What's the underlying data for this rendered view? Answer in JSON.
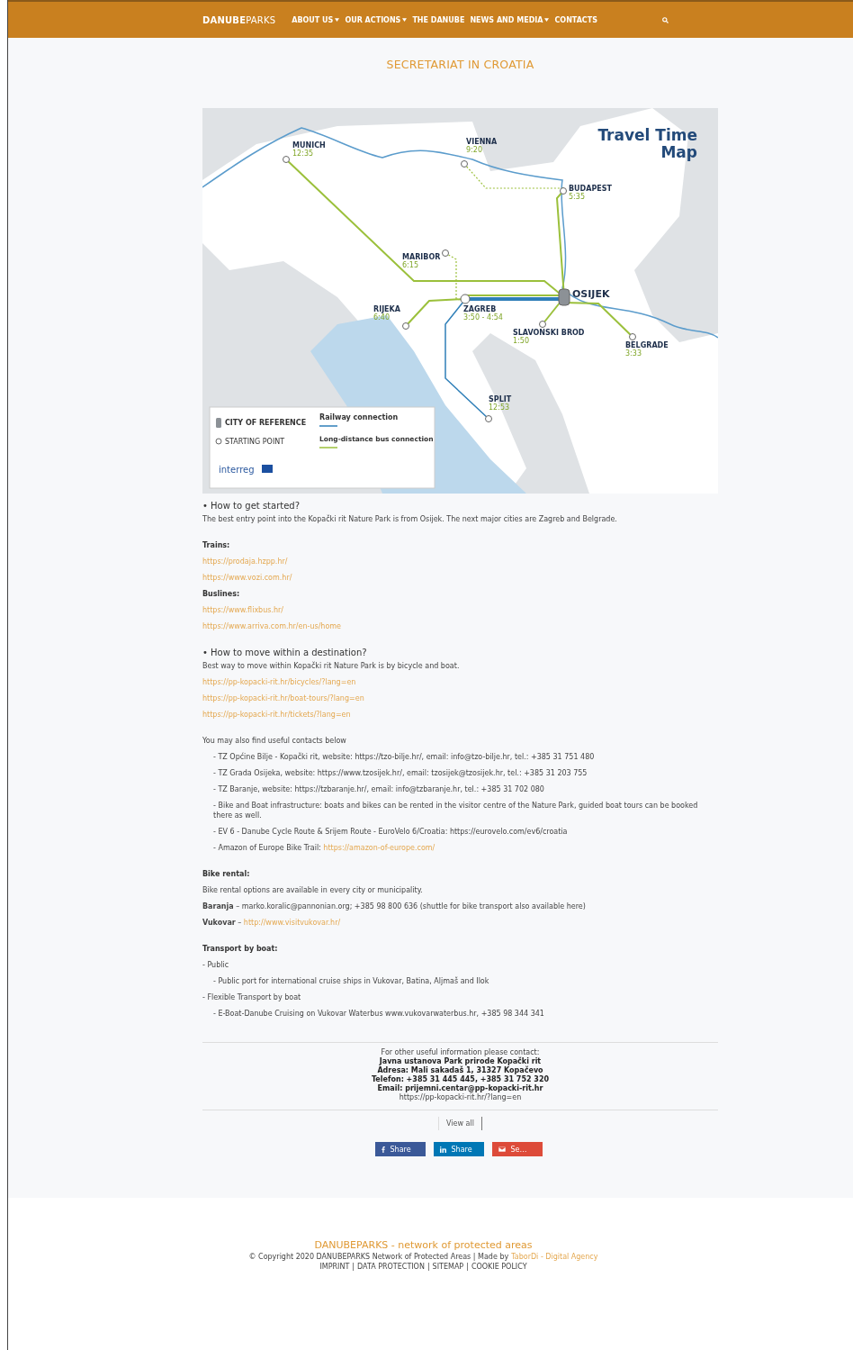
{
  "nav": {
    "logo_bold": "DANUBE",
    "logo_light": "PARKS",
    "items": [
      {
        "label": "ABOUT US",
        "dropdown": true
      },
      {
        "label": "OUR ACTIONS",
        "dropdown": true
      },
      {
        "label": "THE DANUBE",
        "dropdown": false
      },
      {
        "label": "NEWS AND MEDIA",
        "dropdown": true
      },
      {
        "label": "CONTACTS",
        "dropdown": false
      }
    ]
  },
  "title": "SECRETARIAT IN CROATIA",
  "map": {
    "title_lines": [
      "Travel Time",
      "Map"
    ],
    "cities": [
      {
        "name": "MUNICH",
        "time": "12:35",
        "kind": "start"
      },
      {
        "name": "VIENNA",
        "time": "9:20",
        "kind": "start"
      },
      {
        "name": "BUDAPEST",
        "time": "5:35",
        "kind": "start"
      },
      {
        "name": "MARIBOR",
        "time": "6:15",
        "kind": "start"
      },
      {
        "name": "OSIJEK",
        "kind": "reference"
      },
      {
        "name": "RIJEKA",
        "time": "6:40",
        "kind": "start"
      },
      {
        "name": "ZAGREB",
        "time": "3:50 - 4:54",
        "kind": "start"
      },
      {
        "name": "SLAVONSKI BROD",
        "time": "1:50",
        "kind": "start"
      },
      {
        "name": "BELGRADE",
        "time": "3:33",
        "kind": "start"
      },
      {
        "name": "SPLIT",
        "time": "12:53",
        "kind": "start"
      }
    ],
    "legend": {
      "reference": "CITY OF REFERENCE",
      "start": "STARTING POINT",
      "rail": "Railway connection",
      "bus": "Long-distance bus connection",
      "logo": "interreg"
    }
  },
  "groups": [
    [
      {
        "kind": "heading",
        "text": "• How to get started?"
      },
      {
        "kind": "text",
        "text": "The best entry point into the Kopački rit Nature Park is from Osijek. The next major cities are Zagreb and Belgrade."
      }
    ],
    [
      {
        "kind": "label",
        "text": "Trains:"
      },
      {
        "kind": "link",
        "text": "https://prodaja.hzpp.hr/"
      },
      {
        "kind": "link",
        "text": "https://www.vozi.com.hr/"
      },
      {
        "kind": "label",
        "text": "Buslines:"
      },
      {
        "kind": "link",
        "text": "https://www.flixbus.hr/"
      },
      {
        "kind": "link",
        "text": "https://www.arriva.com.hr/en-us/home"
      }
    ],
    [
      {
        "kind": "heading",
        "text": "• How to move within a destination?"
      },
      {
        "kind": "text",
        "text": "Best way to move within Kopački rit Nature Park is by bicycle and boat."
      },
      {
        "kind": "link",
        "text": "https://pp-kopacki-rit.hr/bicycles/?lang=en"
      },
      {
        "kind": "link",
        "text": "https://pp-kopacki-rit.hr/boat-tours/?lang=en"
      },
      {
        "kind": "link",
        "text": "https://pp-kopacki-rit.hr/tickets/?lang=en"
      }
    ],
    [
      {
        "kind": "text",
        "text": "You may also find useful contacts below"
      },
      {
        "kind": "item",
        "text": "- TZ Općine Bilje - Kopački rit, website: https://tzo-bilje.hr/, email: info@tzo-bilje.hr, tel.: +385 31 751 480"
      },
      {
        "kind": "item",
        "text": "- TZ Grada Osijeka, website: https://www.tzosijek.hr/, email: tzosijek@tzosijek.hr, tel.: +385 31 203 755"
      },
      {
        "kind": "item",
        "text": "- TZ Baranje, website: https://tzbaranje.hr/, email: info@tzbaranje.hr, tel.: +385 31 702 080"
      },
      {
        "kind": "item",
        "text": "- Bike and Boat infrastructure: boats and bikes can be rented in the visitor centre of the Nature Park, guided boat tours can be booked there as well."
      },
      {
        "kind": "item",
        "text": "- EV 6 - Danube Cycle Route & Srijem Route - EuroVelo 6/Croatia: https://eurovelo.com/ev6/croatia"
      },
      {
        "kind": "item",
        "text": "- Amazon of Europe Bike Trail:",
        "link": "https://amazon-of-europe.com/"
      }
    ],
    [
      {
        "kind": "label",
        "text": "Bike rental:"
      },
      {
        "kind": "text",
        "text": "Bike rental options are available in every city or municipality."
      },
      {
        "kind": "text",
        "text": "**Baranja** – marko.koralic@pannonian.org; +385 98 800 636 (shuttle for bike transport also available here)"
      },
      {
        "kind": "text",
        "text": "**Vukovar** –",
        "link": "http://www.visitvukovar.hr/"
      }
    ],
    [
      {
        "kind": "label",
        "text": "Transport by boat:"
      },
      {
        "kind": "text",
        "text": "- Public"
      },
      {
        "kind": "item",
        "text": "- Public port for international cruise ships in Vukovar, Batina, Aljmaš and Ilok"
      },
      {
        "kind": "text",
        "text": "- Flexible Transport by boat"
      },
      {
        "kind": "item",
        "text": "- E-Boat-Danube Cruising on Vukovar Waterbus www.vukovarwaterbus.hr, +385 98 344 341"
      }
    ]
  ],
  "contact": [
    {
      "kind": "text",
      "text": "For other useful information please contact:"
    },
    {
      "kind": "bold",
      "text": "Javna ustanova Park prirode Kopački rit"
    },
    {
      "kind": "bold",
      "text": "Adresa: Mali sakadaš 1, 31327 Kopačevo"
    },
    {
      "kind": "bold",
      "text": "Telefon: +385 31 445 445, +385 31 752 320"
    },
    {
      "kind": "bold",
      "text": "Email: prijemni.centar@pp-kopacki-rit.hr"
    },
    {
      "kind": "link",
      "text": "https://pp-kopacki-rit.hr/?lang=en"
    }
  ],
  "view_all": "View all",
  "share": [
    {
      "kind": "facebook",
      "label": "Share",
      "color": "#3b5998"
    },
    {
      "kind": "linkedin",
      "label": "Share",
      "color": "#0077b5"
    },
    {
      "kind": "email",
      "label": "Se…",
      "color": "#dd4b39"
    }
  ],
  "footer": {
    "title": "DANUBEPARKS - network of protected areas",
    "copyright": "© Copyright 2020 DANUBEPARKS Network of Protected Areas | Made by",
    "agency": "TaborDi - Digital Agency",
    "links": [
      "IMPRINT",
      "DATA PROTECTION",
      "SITEMAP",
      "COOKIE POLICY"
    ],
    "separator": "|"
  }
}
